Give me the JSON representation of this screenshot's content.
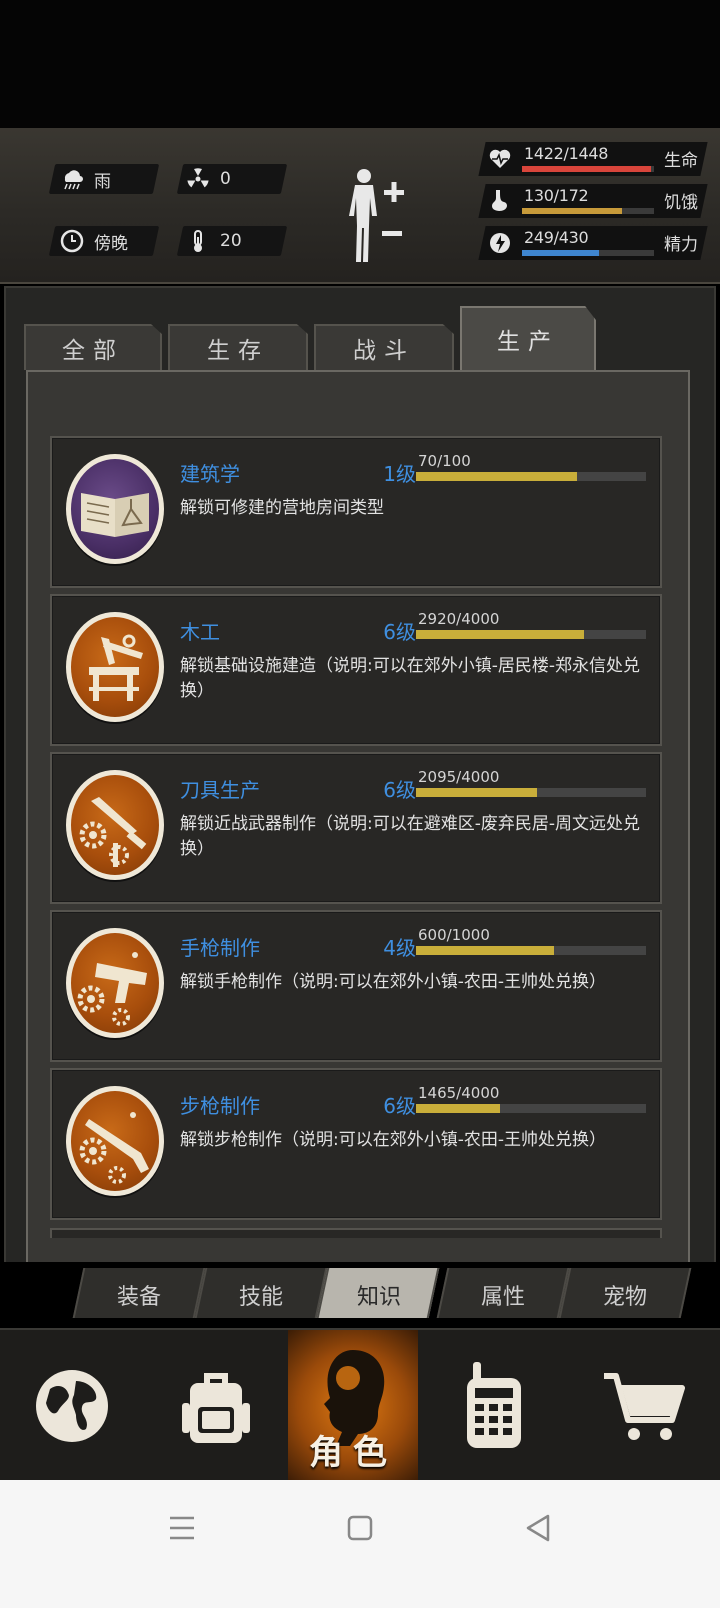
{
  "status": {
    "weather": "雨",
    "radiation": "0",
    "time_of_day": "傍晚",
    "temperature": "20",
    "stats": [
      {
        "value": "1422/1448",
        "name": "生命",
        "fraction": 0.98,
        "color": "#d9453b",
        "icon": "heart-icon"
      },
      {
        "value": "130/172",
        "name": "饥饿",
        "fraction": 0.76,
        "color": "#c79a3a",
        "icon": "stomach-icon"
      },
      {
        "value": "249/430",
        "name": "精力",
        "fraction": 0.58,
        "color": "#3f86d0",
        "icon": "energy-icon"
      }
    ]
  },
  "tabs": [
    {
      "label": "全部"
    },
    {
      "label": "生存"
    },
    {
      "label": "战斗"
    },
    {
      "label": "生产",
      "active": true
    }
  ],
  "skills": [
    {
      "name": "建筑学",
      "level": "1级",
      "progress": "70/100",
      "fraction": 0.7,
      "description": "解锁可修建的营地房间类型",
      "icon": "book-icon",
      "badge": "purple"
    },
    {
      "name": "木工",
      "level": "6级",
      "progress": "2920/4000",
      "fraction": 0.73,
      "description": "解锁基础设施建造（说明:可以在郊外小镇-居民楼-郑永信处兑换）",
      "icon": "woodwork-icon",
      "badge": "orange"
    },
    {
      "name": "刀具生产",
      "level": "6级",
      "progress": "2095/4000",
      "fraction": 0.524,
      "description": "解锁近战武器制作（说明:可以在避难区-废弃民居-周文远处兑换）",
      "icon": "knife-craft-icon",
      "badge": "orange"
    },
    {
      "name": "手枪制作",
      "level": "4级",
      "progress": "600/1000",
      "fraction": 0.6,
      "description": "解锁手枪制作（说明:可以在郊外小镇-农田-王帅处兑换）",
      "icon": "pistol-craft-icon",
      "badge": "orange"
    },
    {
      "name": "步枪制作",
      "level": "6级",
      "progress": "1465/4000",
      "fraction": 0.366,
      "description": "解锁步枪制作（说明:可以在郊外小镇-农田-王帅处兑换）",
      "icon": "rifle-craft-icon",
      "badge": "orange"
    }
  ],
  "subtabs": [
    {
      "label": "装备"
    },
    {
      "label": "技能"
    },
    {
      "label": "知识",
      "active": true
    },
    {
      "label": "属性"
    },
    {
      "label": "宠物"
    }
  ],
  "bottom_nav": {
    "active_label": "角色",
    "items": [
      "globe-icon",
      "backpack-icon",
      "character-icon",
      "radio-icon",
      "cart-icon"
    ]
  }
}
